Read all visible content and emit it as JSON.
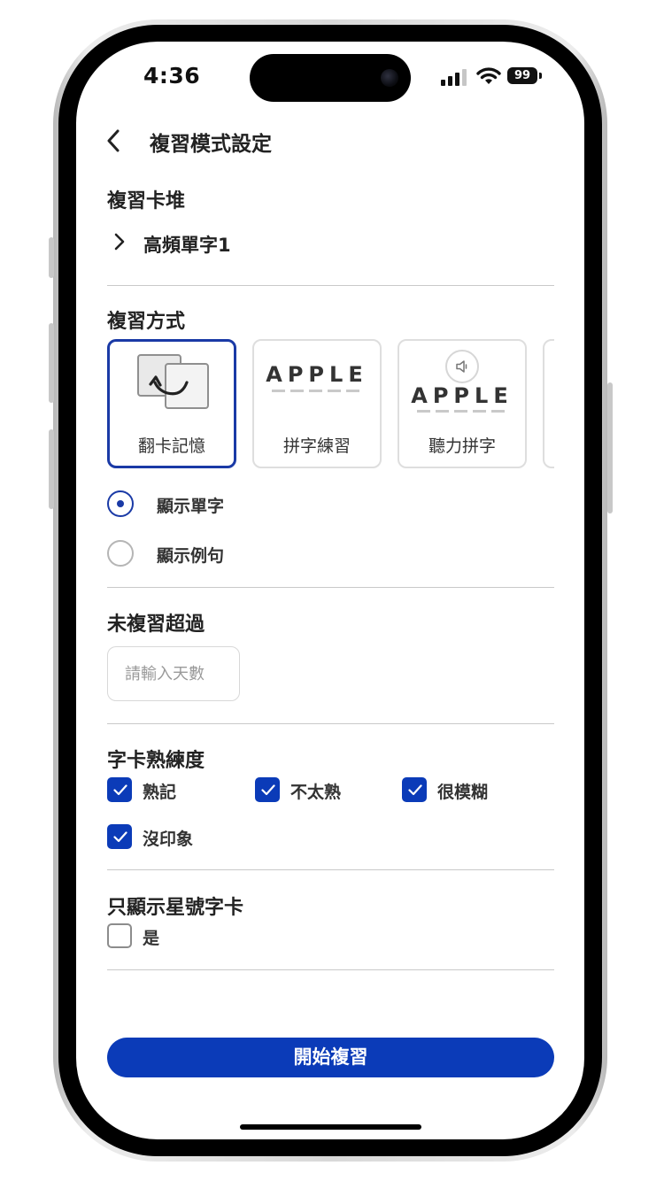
{
  "status_bar": {
    "time": "4:36",
    "battery": "99"
  },
  "header": {
    "back_icon": "chevron-left-icon",
    "title": "複習模式設定"
  },
  "deck": {
    "section_title": "複習卡堆",
    "name": "高頻單字1"
  },
  "method": {
    "section_title": "複習方式",
    "cards": [
      {
        "label": "翻卡記憶",
        "icon": "flip-card-icon",
        "selected": true
      },
      {
        "label": "拼字練習",
        "word": "APPLE",
        "selected": false
      },
      {
        "label": "聽力拼字",
        "word": "APPLE",
        "icon": "speaker-icon",
        "selected": false
      }
    ],
    "display_options": [
      {
        "label": "顯示單字",
        "checked": true
      },
      {
        "label": "顯示例句",
        "checked": false
      }
    ]
  },
  "overdue": {
    "section_title": "未複習超過",
    "input_placeholder": "請輸入天數",
    "input_value": ""
  },
  "proficiency": {
    "section_title": "字卡熟練度",
    "options": [
      {
        "label": "熟記",
        "checked": true
      },
      {
        "label": "不太熟",
        "checked": true
      },
      {
        "label": "很模糊",
        "checked": true
      },
      {
        "label": "沒印象",
        "checked": true
      }
    ]
  },
  "starred": {
    "section_title": "只顯示星號字卡",
    "option_label": "是",
    "checked": false
  },
  "start_button": {
    "label": "開始複習"
  },
  "colors": {
    "accent": "#0b3bb8",
    "selected_border": "#1a3aa6",
    "divider": "#c9c9c9"
  }
}
